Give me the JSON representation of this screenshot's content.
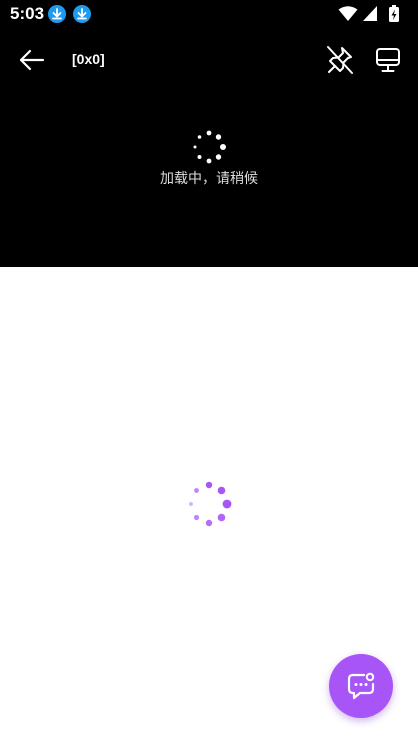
{
  "status_bar": {
    "time": "5:03",
    "notifications": [
      "download-icon",
      "download-icon"
    ],
    "icons": [
      "wifi-icon",
      "cellular-signal-icon",
      "battery-charging-icon"
    ]
  },
  "toolbar": {
    "title": "[0x0]",
    "back_icon": "arrow-left-icon",
    "pin_icon": "pin-off-icon",
    "cast_icon": "monitor-icon"
  },
  "player": {
    "loading_text": "加载中，请稍候"
  },
  "chat_fab": {
    "icon": "chat-bubble-icon"
  },
  "colors": {
    "player_bg": "#000000",
    "accent": "#a855f7",
    "download_badge": "#1e9bf0"
  }
}
